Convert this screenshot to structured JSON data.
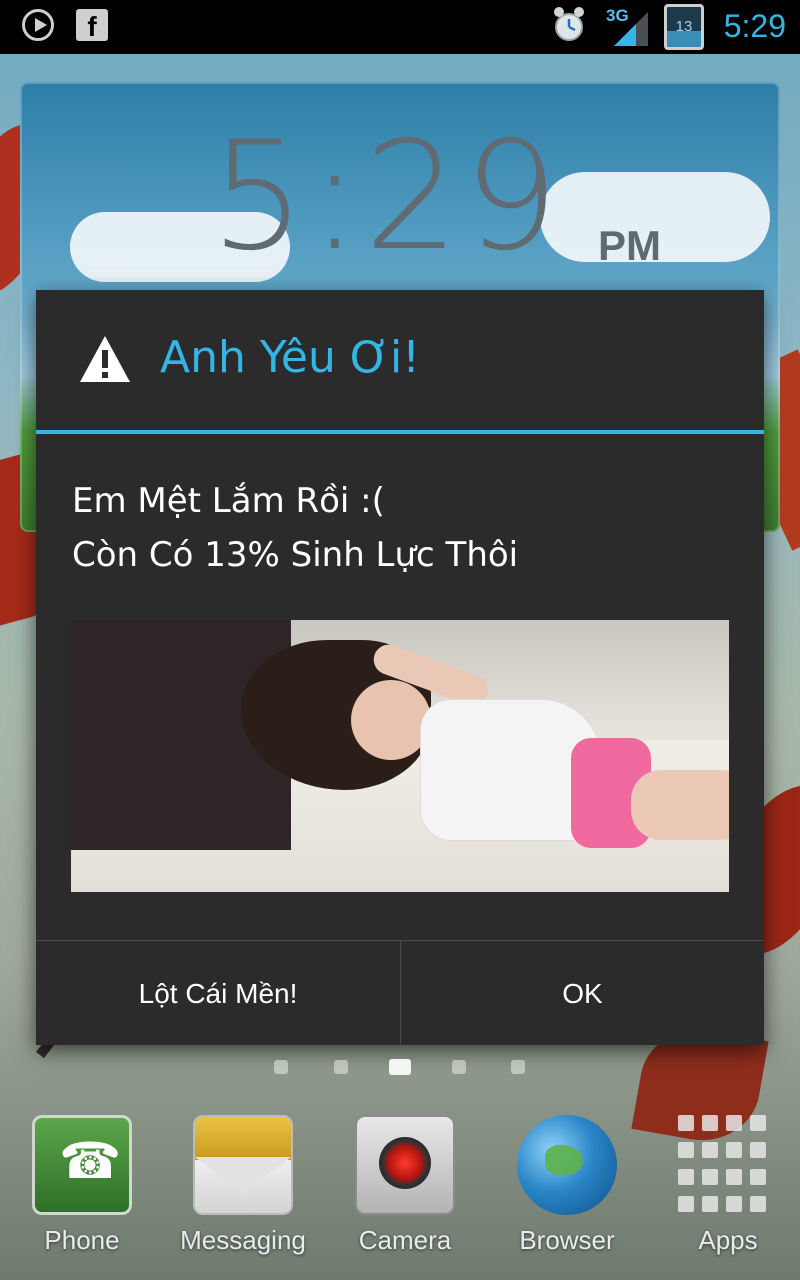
{
  "status_bar": {
    "time": "5:29",
    "network": "3G",
    "battery_level": "13",
    "icons": [
      "play-icon",
      "facebook-icon",
      "alarm-icon",
      "signal-icon",
      "battery-icon"
    ]
  },
  "clock_widget": {
    "time": "5:29",
    "ampm": "PM"
  },
  "dialog": {
    "title": "Anh Yêu Ơi!",
    "icon": "warning-icon",
    "message_lines": [
      "Em Mệt Lắm Rồi :(",
      "Còn Có 13% Sinh Lực Thôi"
    ],
    "buttons": {
      "negative": "Lột Cái Mền!",
      "positive": "OK"
    }
  },
  "pager": {
    "count": 5,
    "active_index": 2
  },
  "dock": {
    "items": [
      {
        "label": "Phone",
        "icon": "phone-icon"
      },
      {
        "label": "Messaging",
        "icon": "messaging-icon"
      },
      {
        "label": "Camera",
        "icon": "camera-icon"
      },
      {
        "label": "Browser",
        "icon": "browser-icon"
      },
      {
        "label": "Apps",
        "icon": "apps-icon"
      }
    ]
  },
  "colors": {
    "accent": "#33b5e5",
    "dialog_bg": "#2b2b2b",
    "status_bar_bg": "#000000"
  }
}
